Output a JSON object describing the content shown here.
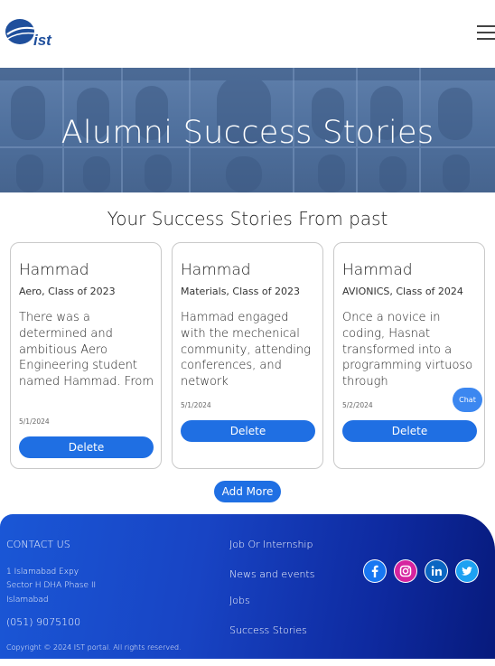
{
  "header": {
    "logo_text": "ist",
    "menu_icon": "hamburger-menu-icon"
  },
  "hero": {
    "title": "Alumni Success Stories"
  },
  "section": {
    "title": "Your Success Stories From past"
  },
  "cards": [
    {
      "name": "Hammad",
      "meta": "Aero, Class of 2023",
      "story": "There was a determined and ambitious Aero Engineering student named Hammad. From",
      "date": "5/1/2024",
      "delete_label": "Delete"
    },
    {
      "name": "Hammad",
      "meta": "Materials, Class of 2023",
      "story": "Hammad engaged with the mechenical community, attending conferences, and network",
      "date": "5/1/2024",
      "delete_label": "Delete"
    },
    {
      "name": "Hammad",
      "meta": "AVIONICS, Class of 2024",
      "story": "Once a novice in coding, Hasnat transformed into a programming virtuoso through",
      "date": "5/2/2024",
      "delete_label": "Delete"
    }
  ],
  "chat_label": "Chat",
  "add_more_label": "Add More",
  "footer": {
    "contact_heading": "CONTACT US",
    "address_line1": "1 Islamabad Expy",
    "address_line2": "Sector H DHA Phase II",
    "address_line3": "Islamabad",
    "phone": "(051) 9075100",
    "copyright": "Copyright © 2024 IST portal. All rights reserved.",
    "links": [
      "Job Or Internship",
      "News and events",
      "Jobs",
      "Success Stories"
    ],
    "social_icons": [
      "facebook-icon",
      "instagram-icon",
      "linkedin-icon",
      "twitter-icon"
    ]
  },
  "colors": {
    "primary_button": "#1f6fe3",
    "footer_start": "#1a57d6",
    "footer_end": "#071a7c",
    "facebook": "#1877f2",
    "instagram": "#d6249f",
    "linkedin": "#0a66c2",
    "twitter": "#1da1f2"
  }
}
